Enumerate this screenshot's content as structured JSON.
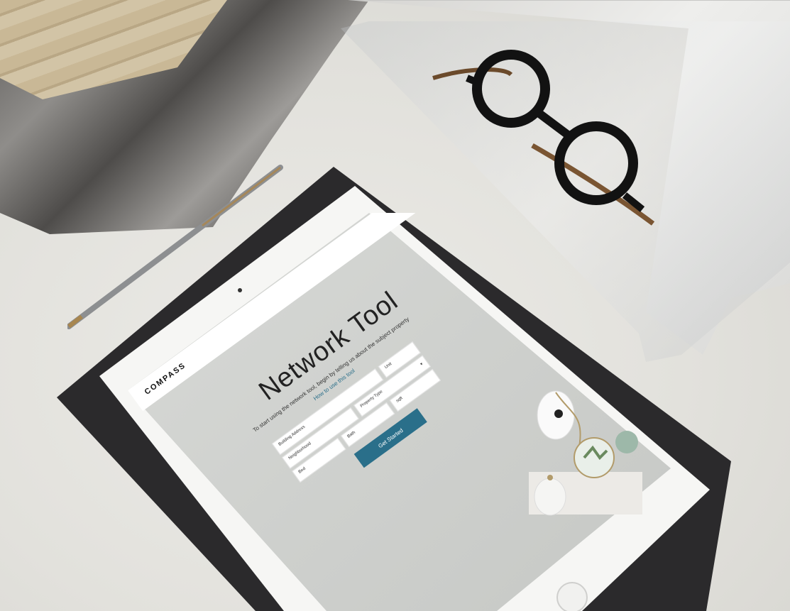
{
  "screen": {
    "brand": "COMPASS",
    "title": "Network Tool",
    "subtitle": "To start using the network tool, begin by telling us about the subject property",
    "how_to_link": "How to use this tool",
    "fields": {
      "building_address": "Building Address",
      "unit": "Unit",
      "neighborhood": "Neighborhood",
      "property_type": "Property Type",
      "bed": "Bed",
      "bath": "Bath",
      "sqft": "sqft"
    },
    "get_started": "Get Started"
  },
  "colors": {
    "accent": "#2a6f8a"
  },
  "icons": {
    "menu": "hamburger-menu-icon",
    "dropdown": "chevron-down-icon"
  }
}
